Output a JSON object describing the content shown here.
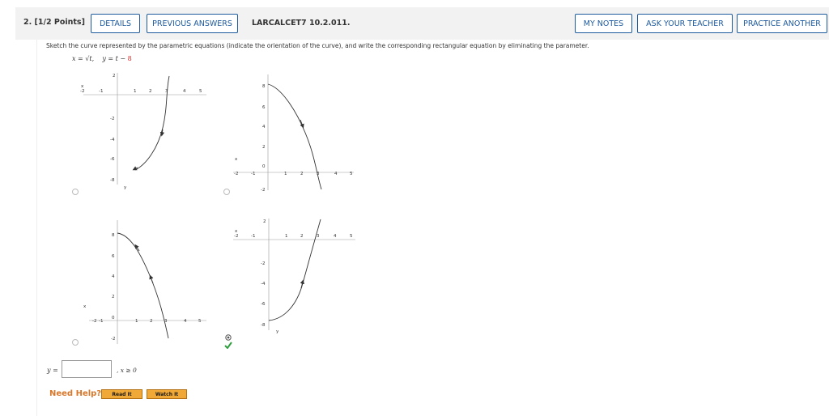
{
  "header": {
    "question_label": "2.  [1/2 Points]",
    "details": "DETAILS",
    "previous_answers": "PREVIOUS ANSWERS",
    "question_id": "LARCALCET7 10.2.011.",
    "my_notes": "MY NOTES",
    "ask_teacher": "ASK YOUR TEACHER",
    "practice_another": "PRACTICE ANOTHER"
  },
  "instruction": "Sketch the curve represented by the parametric equations (indicate the orientation of the curve), and write the corresponding rectangular equation by eliminating the parameter.",
  "equation": {
    "x_part": "x = √t,",
    "y_part": "y = t −",
    "y_const": "8",
    "const_color": "#d62e2e"
  },
  "graphs": [
    {
      "id": "a",
      "x_ticks": [
        "-2",
        "-1",
        "1",
        "2",
        "3",
        "4",
        "5"
      ],
      "y_ticks": [
        "2",
        "-2",
        "-4",
        "-6",
        "-8"
      ],
      "x_label": "x",
      "y_label": "y",
      "selected": false
    },
    {
      "id": "b",
      "x_ticks": [
        "-2",
        "-1",
        "1",
        "2",
        "3",
        "4",
        "5"
      ],
      "y_ticks": [
        "8",
        "6",
        "4",
        "2",
        "0",
        "-2"
      ],
      "x_label": "x",
      "selected": false
    },
    {
      "id": "c",
      "x_ticks": [
        "-2",
        "-1",
        "1",
        "2",
        "3",
        "4",
        "5"
      ],
      "y_ticks": [
        "8",
        "6",
        "4",
        "2",
        "0",
        "-2"
      ],
      "x_label": "x",
      "selected": false
    },
    {
      "id": "d",
      "x_ticks": [
        "-2",
        "-1",
        "1",
        "2",
        "3",
        "4",
        "5"
      ],
      "y_ticks": [
        "2",
        "-2",
        "-4",
        "-6",
        "-8"
      ],
      "x_label": "x",
      "y_label": "y",
      "selected": true
    }
  ],
  "answer": {
    "prefix": "y =",
    "value": "",
    "condition": ", x ≥ 0"
  },
  "help": {
    "label": "Need Help?",
    "read_it": "Read It",
    "watch_it": "Watch It"
  },
  "colors": {
    "link_blue": "#1d5a9e",
    "help_orange": "#d9772a",
    "button_orange": "#f0a936",
    "check_green": "#2e9e3e"
  }
}
